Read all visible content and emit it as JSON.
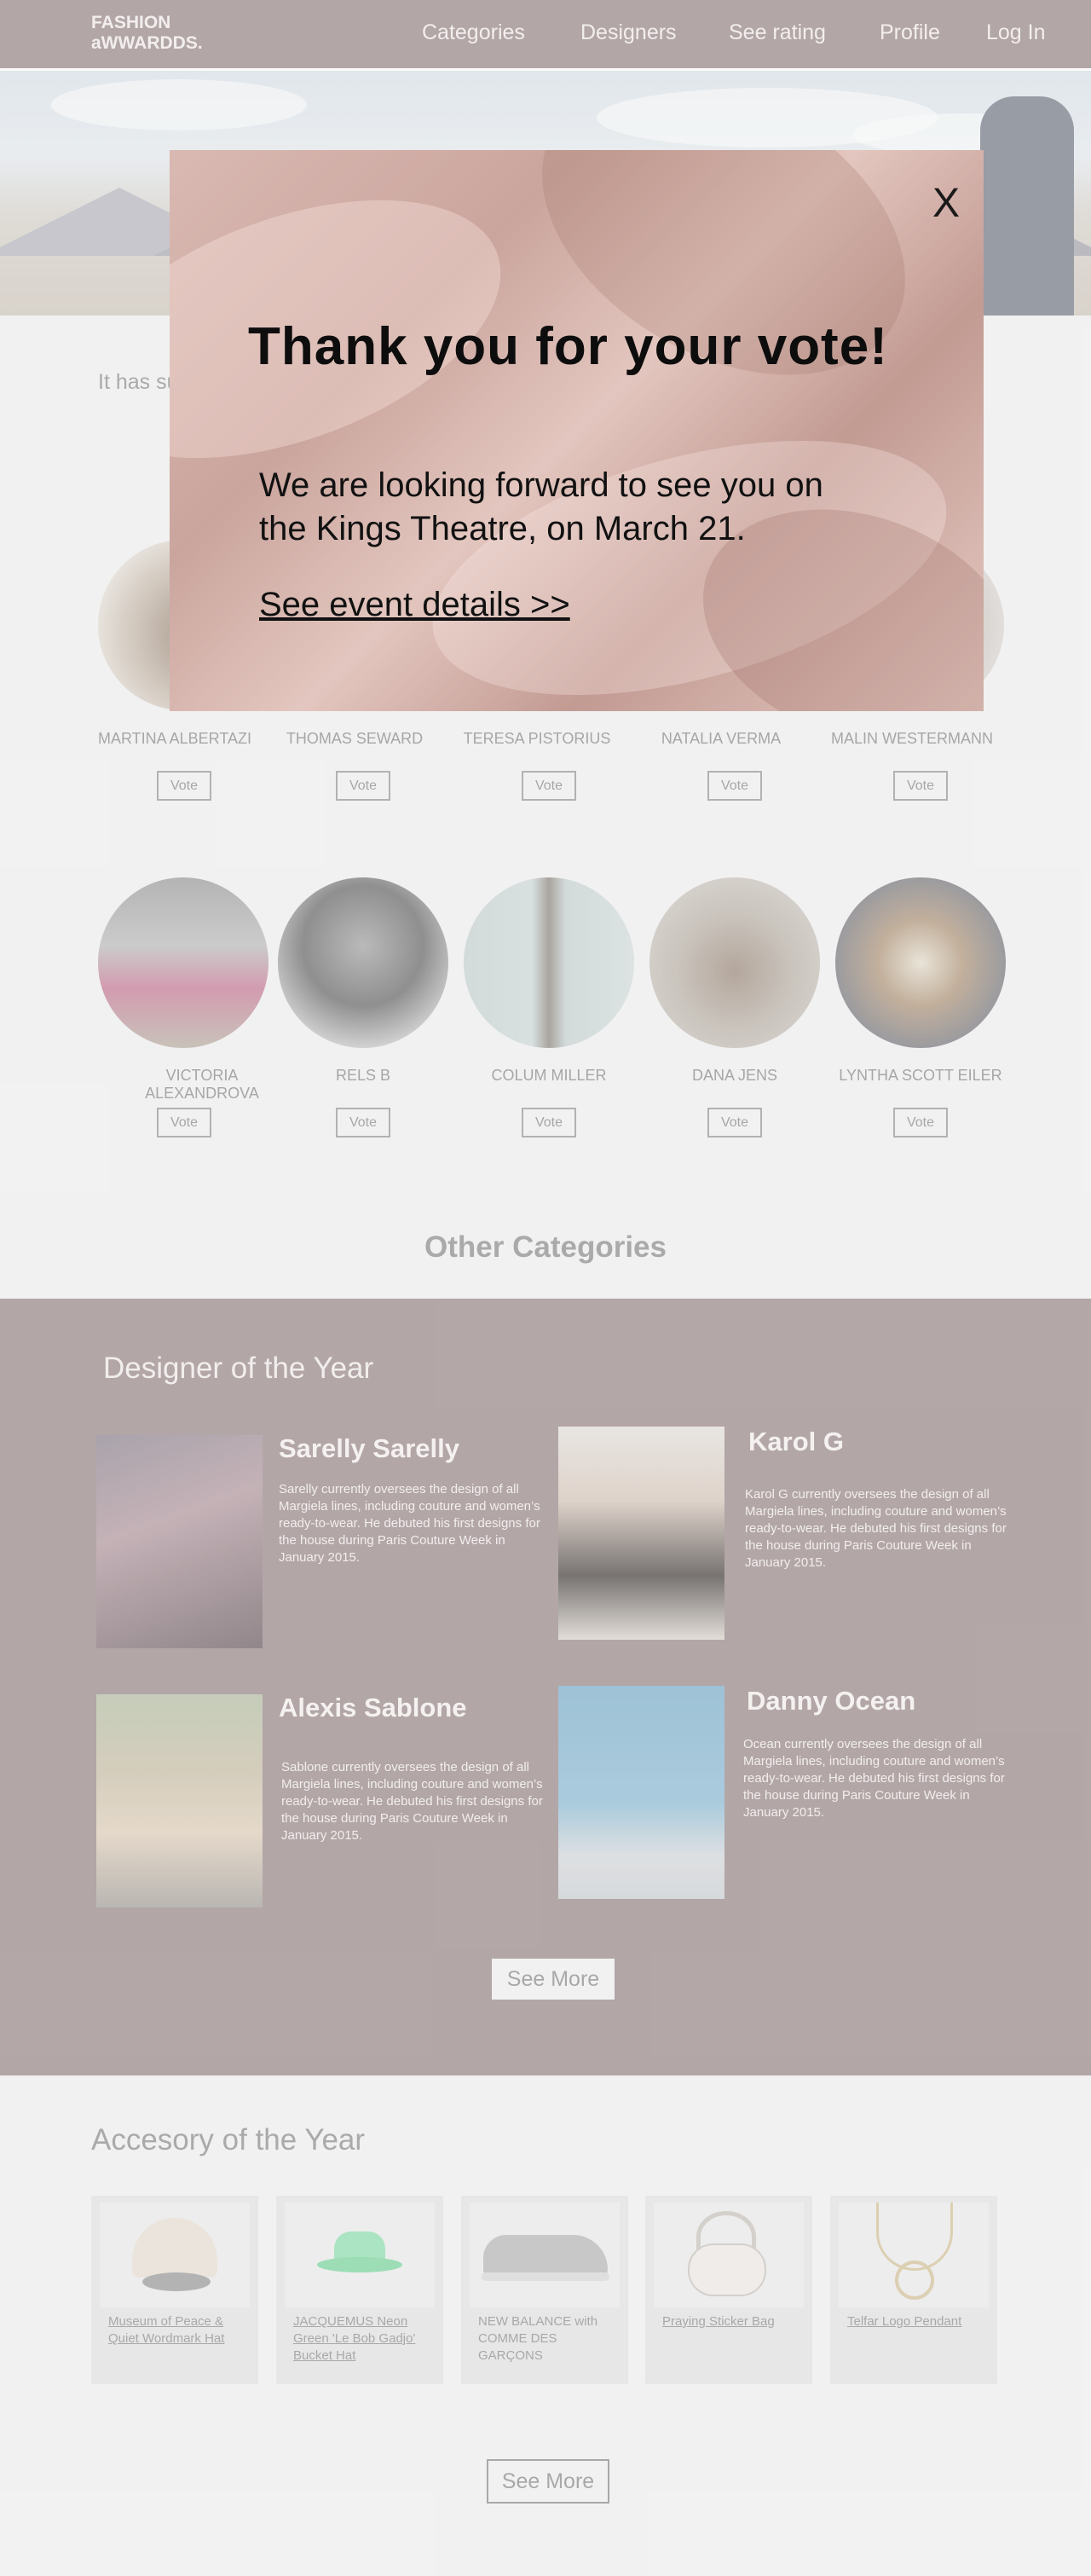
{
  "header": {
    "brand": "FASHION aWWARDDS.",
    "brand_line1": "FASHION",
    "brand_line2": "aWWARDDS.",
    "nav": [
      "Categories",
      "Designers",
      "See rating",
      "Profile",
      "Log In"
    ]
  },
  "intro": {
    "text": "It has su essentia contain Aldus P"
  },
  "nominees_row1": [
    {
      "name": "MARTINA ALBERTAZI",
      "vote": "Vote"
    },
    {
      "name": "THOMAS SEWARD",
      "vote": "Vote"
    },
    {
      "name": "TERESA PISTORIUS",
      "vote": "Vote"
    },
    {
      "name": "NATALIA VERMA",
      "vote": "Vote"
    },
    {
      "name": "MALIN WESTERMANN",
      "vote": "Vote"
    }
  ],
  "nominees_row2": [
    {
      "name": "VICTORIA ALEXANDROVA",
      "vote": "Vote"
    },
    {
      "name": "RELS B",
      "vote": "Vote"
    },
    {
      "name": "COLUM MILLER",
      "vote": "Vote"
    },
    {
      "name": "DANA JENS",
      "vote": "Vote"
    },
    {
      "name": "LYNTHA SCOTT EILER",
      "vote": "Vote"
    }
  ],
  "other_categories": {
    "title": "Other Categories"
  },
  "designer_section": {
    "title": "Designer of the Year",
    "designers": [
      {
        "name": "Sarelly Sarelly",
        "desc": "Sarelly currently oversees the design of all Margiela lines, including couture and women’s ready-to-wear. He debuted his first designs for the house during Paris Couture Week in January 2015."
      },
      {
        "name": "Karol G",
        "desc": "Karol G currently oversees the design of all Margiela lines, including couture and women’s ready-to-wear. He debuted his first designs for the house during Paris Couture Week in January 2015."
      },
      {
        "name": "Alexis Sablone",
        "desc": "Sablone currently oversees the design of all Margiela lines, including couture and women’s ready-to-wear. He debuted his first designs for the house during Paris Couture Week in January 2015."
      },
      {
        "name": "Danny Ocean",
        "desc": "Ocean currently oversees the design of all Margiela lines, including couture and women’s ready-to-wear. He debuted his first designs for the house during Paris Couture Week in January 2015."
      }
    ],
    "see_more": "See More"
  },
  "accessory_section": {
    "title": "Accesory of the Year",
    "items": [
      {
        "label": "Museum of Peace & Quiet Wordmark Hat"
      },
      {
        "label": "JACQUEMUS Neon Green 'Le Bob Gadjo' Bucket Hat"
      },
      {
        "label": "NEW BALANCE with COMME DES GARÇONS"
      },
      {
        "label": "Praying Sticker Bag"
      },
      {
        "label": "Telfar Logo Pendant"
      }
    ],
    "see_more": "See More"
  },
  "modal": {
    "close": "X",
    "title": "Thank you for your vote!",
    "body": "We are looking forward to see you on the Kings Theatre, on March 21.",
    "link": "See event details >>"
  },
  "colors": {
    "header_bg": "#9c8a8b",
    "band_bg": "#9c8a8b",
    "page_bg": "#f2f2f2",
    "modal_bg": "#d9b9b2"
  }
}
